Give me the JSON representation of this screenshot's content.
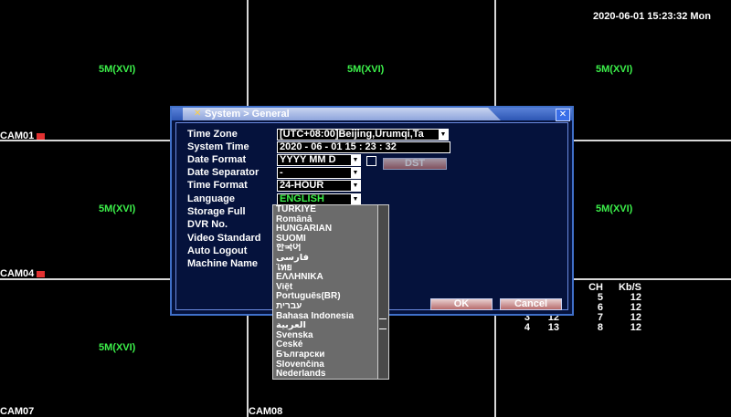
{
  "clock": "2020-06-01 15:23:32 Mon",
  "cells": {
    "label": "5M(XVI)"
  },
  "cams": {
    "cam01": "CAM01",
    "cam04": "CAM04",
    "cam07": "CAM07",
    "cam08": "CAM08"
  },
  "stats": {
    "headers": [
      "CH",
      "Kb/S"
    ],
    "rows": [
      [
        "",
        "",
        "5",
        "12"
      ],
      [
        "",
        "",
        "6",
        "12"
      ],
      [
        "3",
        "12",
        "7",
        "12"
      ],
      [
        "4",
        "13",
        "8",
        "12"
      ]
    ]
  },
  "dialog": {
    "title": "System > General",
    "labels": {
      "time_zone": "Time Zone",
      "system_time": "System Time",
      "date_format": "Date Format",
      "date_separator": "Date Separator",
      "time_format": "Time Format",
      "language": "Language",
      "storage_full": "Storage Full",
      "dvr_no": "DVR No.",
      "video_standard": "Video Standard",
      "auto_logout": "Auto Logout",
      "machine_name": "Machine Name"
    },
    "values": {
      "time_zone": "[UTC+08:00]Beijing,Urumqi,Ta",
      "system_time": "2020 - 06 - 01   15 : 23 : 32",
      "date_format": "YYYY MM D",
      "date_separator": "-",
      "time_format": "24-HOUR",
      "language": "ENGLISH"
    },
    "dst_label": "DST",
    "ok_label": "OK",
    "cancel_label": "Cancel",
    "close_glyph": "✕"
  },
  "languages": [
    "TÜRKIYE",
    "Română",
    "HUNGARIAN",
    "SUOMI",
    "한국어",
    "فارسی",
    "ไทย",
    "ΕΛΛΗΝΙΚΑ",
    "Việt",
    "Português(BR)",
    "עברית",
    "Bahasa Indonesia",
    "العربية",
    "Svenska",
    "České",
    "Български",
    "Slovenčina",
    "Nederlands"
  ],
  "colors": {
    "label_green": "#3cf04a",
    "language_value": "#3cf04a",
    "dialog_bg": "#05123c"
  }
}
